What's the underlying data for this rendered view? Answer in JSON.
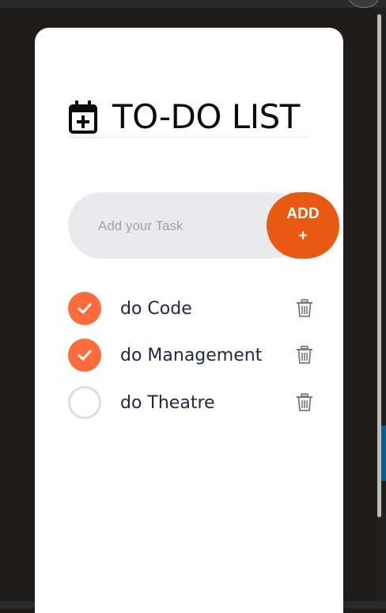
{
  "app": {
    "title": "TO-DO LIST"
  },
  "input": {
    "placeholder": "Add your Task",
    "value": ""
  },
  "add_button": {
    "line1": "ADD",
    "line2": "+"
  },
  "tasks": [
    {
      "label": "do Code",
      "done": true
    },
    {
      "label": "do Management",
      "done": true
    },
    {
      "label": "do Theatre",
      "done": false
    }
  ],
  "icons": {
    "header": "calendar-plus-icon",
    "check": "check-icon",
    "delete": "trash-icon"
  },
  "colors": {
    "accent_button": "#e85a12",
    "checked": "#ff6b3d",
    "input_bg": "#e9eaee",
    "text": "#23293d"
  }
}
